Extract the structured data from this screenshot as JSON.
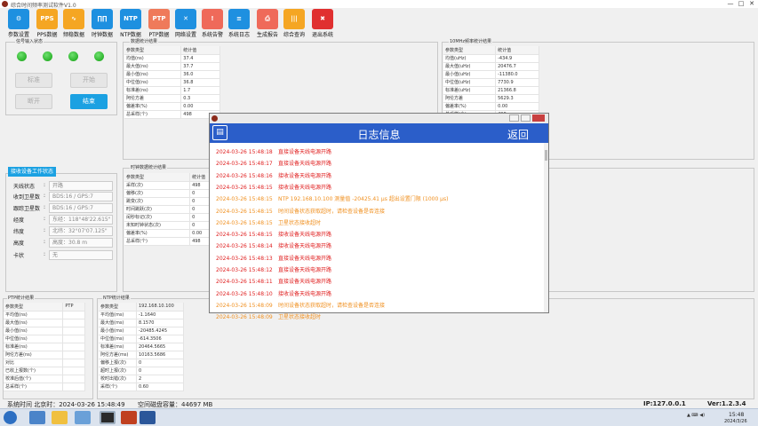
{
  "window": {
    "title": "综合时间频率测试软件V1.0",
    "min": "—",
    "max": "□",
    "close": "✕"
  },
  "toolbar": [
    {
      "label": "参数设置",
      "icon": "gear-icon",
      "color": "#1e90e0",
      "glyph": "⚙"
    },
    {
      "label": "PPS数据",
      "icon": "pps-icon",
      "color": "#f5a623",
      "glyph": "PPS"
    },
    {
      "label": "频稳数据",
      "icon": "wave-icon",
      "color": "#f5a623",
      "glyph": "∿"
    },
    {
      "label": "时钟数据",
      "icon": "clock-icon",
      "color": "#1e90e0",
      "glyph": "∏∏"
    },
    {
      "label": "NTP数据",
      "icon": "ntp-icon",
      "color": "#1e90e0",
      "glyph": "NTP"
    },
    {
      "label": "PTP数据",
      "icon": "ptp-icon",
      "color": "#ef7a5a",
      "glyph": "PTP"
    },
    {
      "label": "网络设置",
      "icon": "tools-icon",
      "color": "#1e90e0",
      "glyph": "✕"
    },
    {
      "label": "系统告警",
      "icon": "warning-icon",
      "color": "#ef6a5a",
      "glyph": "!"
    },
    {
      "label": "系统日志",
      "icon": "log-icon",
      "color": "#1e90e0",
      "glyph": "≡"
    },
    {
      "label": "生成报告",
      "icon": "printer-icon",
      "color": "#ef6a5a",
      "glyph": "⎙"
    },
    {
      "label": "综合查询",
      "icon": "query-icon",
      "color": "#f5a623",
      "glyph": "|||"
    },
    {
      "label": "退出系统",
      "icon": "exit-icon",
      "color": "#e03030",
      "glyph": "✖"
    }
  ],
  "signal": {
    "title": "信号输入状态",
    "buttons": {
      "calibrate": "标准",
      "start": "开始",
      "disconnect": "断开",
      "end": "结束"
    }
  },
  "stats_top": {
    "title": "数据统计结果",
    "head": [
      "参数类型",
      "统计值"
    ],
    "rows": [
      [
        "均值(ns)",
        "37.4"
      ],
      [
        "最大值(ns)",
        "37.7"
      ],
      [
        "最小值(ns)",
        "36.0"
      ],
      [
        "中位值(ns)",
        "36.8"
      ],
      [
        "标准差(ns)",
        "1.7"
      ],
      [
        "阿伦方差",
        "0.3"
      ],
      [
        "偏差率(%)",
        "0.00"
      ],
      [
        "总采样(个)",
        "498"
      ]
    ]
  },
  "stats_right": {
    "title": "10MHz频率统计结果",
    "head": [
      "参数类型",
      "统计值"
    ],
    "rows": [
      [
        "均值(uHz)",
        "-434.9"
      ],
      [
        "最大值(uHz)",
        "20476.7"
      ],
      [
        "最小值(uHz)",
        "-11380.0"
      ],
      [
        "中位值(uHz)",
        "7730.9"
      ],
      [
        "标准差(uHz)",
        "21366.8"
      ],
      [
        "阿伦方差",
        "5629.3"
      ],
      [
        "偏差率(%)",
        "0.00"
      ],
      [
        "总采样(个)",
        "498"
      ]
    ]
  },
  "stats_mid": {
    "title": "时钟数据统计结果",
    "head": [
      "参数类型",
      "统计值"
    ],
    "rows": [
      [
        "采样(次)",
        "498"
      ],
      [
        "偏移(次)",
        "0"
      ],
      [
        "跳变(次)",
        "0"
      ],
      [
        "时间跳跃(次)",
        "0"
      ],
      [
        "闰秒标记(次)",
        "0"
      ],
      [
        "未知时钟状态(次)",
        "0"
      ],
      [
        "偏差率(%)",
        "0.00"
      ],
      [
        "总采样(个)",
        "498"
      ]
    ]
  },
  "device": {
    "title": "接收设备工作状态",
    "fields": [
      [
        "天线状态",
        "开路"
      ],
      [
        "收到卫星数",
        "BDS:16 / GPS:7"
      ],
      [
        "跟踪卫星数",
        "BDS:16 / GPS:7"
      ],
      [
        "经度",
        "东经：118°48'22.615\""
      ],
      [
        "纬度",
        "北纬：32°07'07.125\""
      ],
      [
        "高度",
        "高度：30.8 m"
      ],
      [
        "卡状",
        "无"
      ]
    ]
  },
  "ptp": {
    "title": "PTP统计结果",
    "head": [
      "参数类型",
      "PTP"
    ],
    "rows": [
      [
        "平均值(ns)",
        ""
      ],
      [
        "最大值(ns)",
        ""
      ],
      [
        "最小值(ns)",
        ""
      ],
      [
        "中位值(ns)",
        ""
      ],
      [
        "标准差(ns)",
        ""
      ],
      [
        "阿伦方差(ns)",
        ""
      ],
      [
        "对比",
        ""
      ],
      [
        "已收上报数(个)",
        ""
      ],
      [
        "校准后值(个)",
        ""
      ],
      [
        "总采样(个)",
        ""
      ]
    ]
  },
  "ntp": {
    "title": "NTP统计结果",
    "head": [
      "参数类型",
      "192.168.10.100"
    ],
    "rows": [
      [
        "平均值(ms)",
        "-1.1640"
      ],
      [
        "最大值(ms)",
        "8.1570"
      ],
      [
        "最小值(ms)",
        "-20485.4245"
      ],
      [
        "中位值(ms)",
        "-614.3506"
      ],
      [
        "标准差(ms)",
        "20464.5665"
      ],
      [
        "阿伦方差(ms)",
        "10163.5686"
      ],
      [
        "偏移上报(次)",
        "0"
      ],
      [
        "超时上报(次)",
        "0"
      ],
      [
        "校时出错(次)",
        "2"
      ],
      [
        "采样(个)",
        "0.60"
      ]
    ]
  },
  "log_dialog": {
    "title": "日志信息",
    "back": "返回",
    "entries": [
      {
        "ts": "2024-03-26 15:48:18",
        "msg": "直接设备天线电源开路",
        "lvl": "red"
      },
      {
        "ts": "2024-03-26 15:48:17",
        "msg": "直接设备天线电源开路",
        "lvl": "red"
      },
      {
        "ts": "2024-03-26 15:48:16",
        "msg": "接收设备天线电源开路",
        "lvl": "red"
      },
      {
        "ts": "2024-03-26 15:48:15",
        "msg": "接收设备天线电源开路",
        "lvl": "red"
      },
      {
        "ts": "2024-03-26 15:48:15",
        "msg": "NTP 192.168.10.100 测量值 -20425.41 μs 超出设置门限 (1000 μs)",
        "lvl": "orange"
      },
      {
        "ts": "2024-03-26 15:48:15",
        "msg": "时间设备状态获取超时，请检查设备是否连接",
        "lvl": "orange"
      },
      {
        "ts": "2024-03-26 15:48:15",
        "msg": "卫星状态接收超时",
        "lvl": "orange"
      },
      {
        "ts": "2024-03-26 15:48:15",
        "msg": "接收设备天线电源开路",
        "lvl": "red"
      },
      {
        "ts": "2024-03-26 15:48:14",
        "msg": "接收设备天线电源开路",
        "lvl": "red"
      },
      {
        "ts": "2024-03-26 15:48:13",
        "msg": "直接设备天线电源开路",
        "lvl": "red"
      },
      {
        "ts": "2024-03-26 15:48:12",
        "msg": "直接设备天线电源开路",
        "lvl": "red"
      },
      {
        "ts": "2024-03-26 15:48:11",
        "msg": "直接设备天线电源开路",
        "lvl": "red"
      },
      {
        "ts": "2024-03-26 15:48:10",
        "msg": "接收设备天线电源开路",
        "lvl": "red"
      },
      {
        "ts": "2024-03-26 15:48:09",
        "msg": "时间设备状态获取超时，请检查设备是否连接",
        "lvl": "orange"
      },
      {
        "ts": "2024-03-26 15:48:09",
        "msg": "卫星状态接收超时",
        "lvl": "orange"
      }
    ]
  },
  "status": {
    "time": "系统时间 北京时：2024-03-26 15:48:49",
    "disk": "空间磁盘容量：44697 MB",
    "ip": "IP:127.0.0.1",
    "ver": "Ver:1.2.3.4"
  },
  "taskbar": {
    "time": "15:48",
    "date": "2024/3/26"
  },
  "colors": {
    "red": "#e02020",
    "orange": "#f09020",
    "blue": "#2b5ec9"
  }
}
